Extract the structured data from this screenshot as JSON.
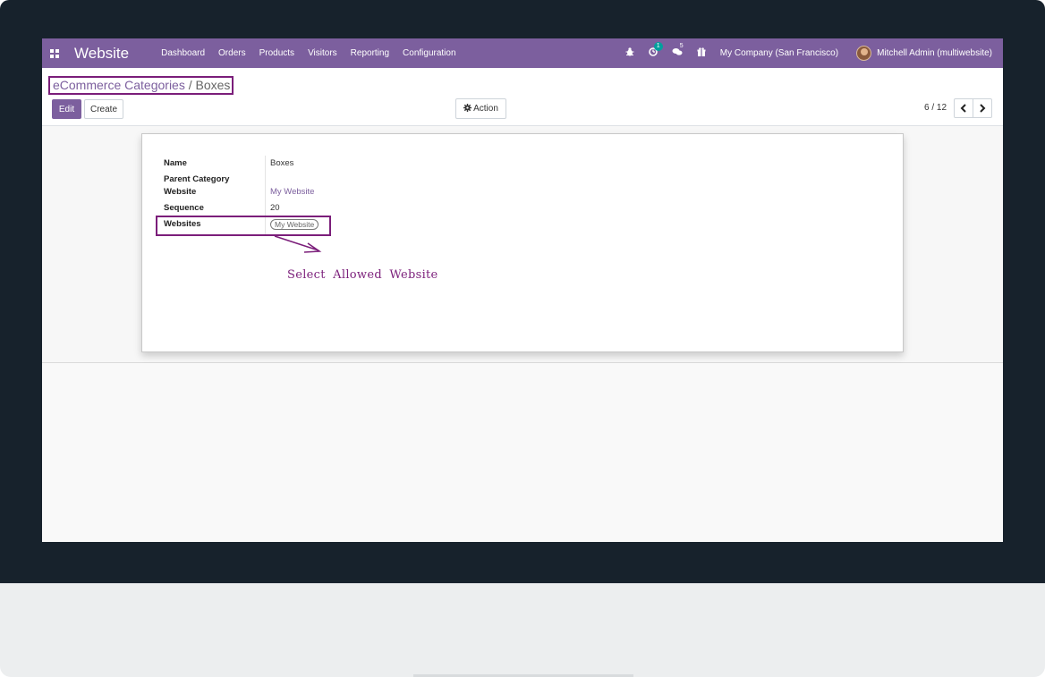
{
  "navbar": {
    "brand": "Website",
    "menu": [
      "Dashboard",
      "Orders",
      "Products",
      "Visitors",
      "Reporting",
      "Configuration"
    ],
    "activity_badge": "1",
    "messages_badge": "5",
    "company": "My Company (San Francisco)",
    "user": "Mitchell Admin (multiwebsite)"
  },
  "control_panel": {
    "breadcrumb_parent": "eCommerce Categories",
    "breadcrumb_separator": " / ",
    "breadcrumb_current": "Boxes",
    "edit_label": "Edit",
    "create_label": "Create",
    "action_label": "Action",
    "pager": "6 / 12"
  },
  "form": {
    "fields": [
      {
        "label": "Name",
        "value": "Boxes"
      },
      {
        "label": "Parent Category",
        "value": ""
      },
      {
        "label": "Website",
        "value": "My Website"
      },
      {
        "label": "Sequence",
        "value": "20"
      },
      {
        "label": "Websites",
        "value": "My Website"
      }
    ]
  },
  "annotation": {
    "text": "Select Allowed Website",
    "color": "#7b1e7a"
  },
  "colors": {
    "primary": "#7c5f9e",
    "frame": "#17222c",
    "badge": "#00a09d"
  },
  "icons": [
    "apps-icon",
    "bug-icon",
    "activity-icon",
    "chat-icon",
    "gift-icon",
    "gear-icon",
    "chevron-left-icon",
    "chevron-right-icon"
  ]
}
